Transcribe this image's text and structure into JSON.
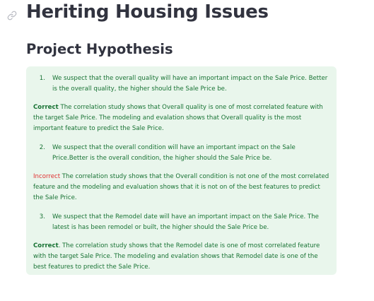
{
  "header": {
    "link_icon": "link-icon",
    "title": "Heriting Housing Issues"
  },
  "section": {
    "title": "Project Hypothesis"
  },
  "callout": {
    "color": "#177233",
    "background": "#e9f6ec",
    "items": [
      {
        "number": "1.",
        "hypothesis": "We suspect that the overall quality will have an important impact on the Sale Price. Better is the overall quality, the higher should the Sale Price be.",
        "verdict_label": "Correct",
        "verdict_text": " The correlation study shows that Overall quality is one of most correlated feature with the target Sale Price. The modeling and evalation shows that Overall quality is the most important feature to predict the Sale Price."
      },
      {
        "number": "2.",
        "hypothesis": "We suspect that the overall condition will have an important impact on the Sale Price.Better is the overall condition, the higher should the Sale Price be.",
        "verdict_label": "Incorrect",
        "verdict_label_color": "#e02f2f",
        "verdict_text": " The correlation study shows that the Overall condition is not one of the most correlated feature and the modeling and evaluation shows that it is not on of the best features to predict the Sale Price."
      },
      {
        "number": "3.",
        "hypothesis": "We suspect that the Remodel date will have an important impact on the Sale Price. The latest is has been remodel or built, the higher should the Sale Price be.",
        "verdict_label": "Correct",
        "verdict_text": ". The correlation study shows that the Remodel date is one of most correlated feature with the target Sale Price. The modeling and evalation shows that Remodel date is one of the best features to predict the Sale Price."
      }
    ]
  }
}
